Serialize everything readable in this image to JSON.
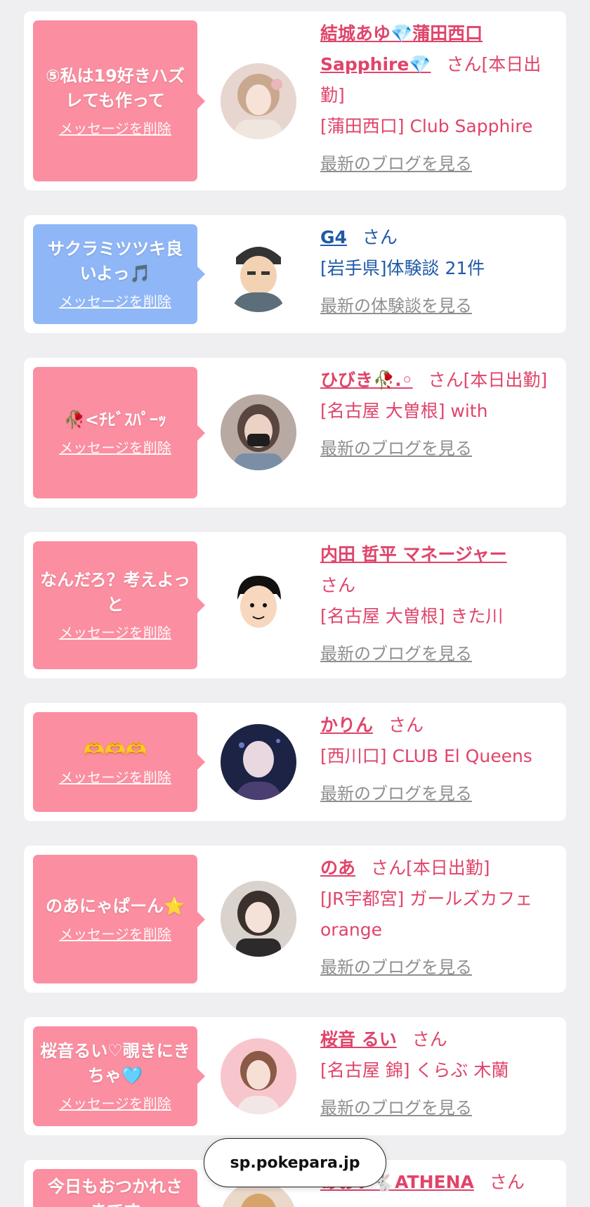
{
  "delete_label": "メッセージを削除",
  "san_label": "さん",
  "url_bar": "sp.pokepara.jp",
  "cards": [
    {
      "message": "⑤私は19好きハズレても作って",
      "name": "結城あゆ💎蒲田西口Sapphire💎",
      "status": "[本日出勤]",
      "shop": "[蒲田西口] Club Sapphire",
      "link": "最新のブログを見る",
      "bubble_color": "#fb8ea0"
    },
    {
      "message": "サクラミツツキ良いよっ🎵",
      "name": "G4",
      "status": "",
      "shop": "[岩手県]体験談 21件",
      "link": "最新の体験談を見る",
      "bubble_color": "#8fb6f6"
    },
    {
      "message": "🥀<ﾁﾋﾞｽﾊﾟｰｯ",
      "name": "ひびき🥀.◦",
      "status": "[本日出勤]",
      "shop": "[名古屋 大曽根] with",
      "link": "最新のブログを見る",
      "bubble_color": "#fb8ea0"
    },
    {
      "message": "なんだろ？考えよっと",
      "name": "内田 哲平 マネージャー",
      "status": "",
      "shop": "[名古屋 大曽根] きた川",
      "link": "最新のブログを見る",
      "bubble_color": "#fb8ea0"
    },
    {
      "message": "🫶🫶🫶",
      "name": "かりん",
      "status": "",
      "shop": "[西川口] CLUB El Queens",
      "link": "最新のブログを見る",
      "bubble_color": "#fb8ea0"
    },
    {
      "message": "のあにゃぱーん⭐",
      "name": "のあ",
      "status": "[本日出勤]",
      "shop": "[JR宇都宮] ガールズカフェ orange",
      "link": "最新のブログを見る",
      "bubble_color": "#fb8ea0"
    },
    {
      "message": "桜音るい♡覗きにきちゃ🩵",
      "name": "桜音 るい",
      "status": "",
      "shop": "[名古屋 錦] くらぶ 木蘭",
      "link": "最新のブログを見る",
      "bubble_color": "#fb8ea0"
    },
    {
      "message": "今日もおつかれさまです",
      "name": "あおい🐇ATHENA",
      "status": "",
      "shop": "",
      "link": "",
      "bubble_color": "#fb8ea0"
    }
  ]
}
